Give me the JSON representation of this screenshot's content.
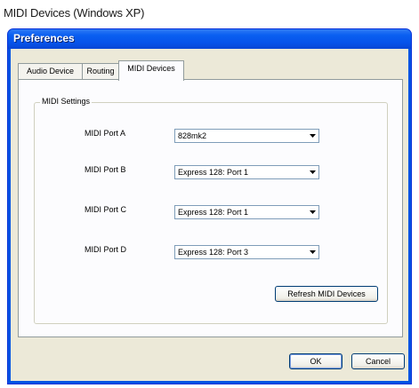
{
  "caption": "MIDI Devices (Windows XP)",
  "window": {
    "title": "Preferences"
  },
  "tabs": [
    {
      "label": "Audio Device"
    },
    {
      "label": "Routing"
    },
    {
      "label": "MIDI Devices"
    }
  ],
  "midi_settings": {
    "legend": "MIDI Settings",
    "ports": [
      {
        "label": "MIDI Port A",
        "value": "828mk2"
      },
      {
        "label": "MIDI Port B",
        "value": "Express  128: Port 1"
      },
      {
        "label": "MIDI Port C",
        "value": "Express  128: Port 1"
      },
      {
        "label": "MIDI Port D",
        "value": "Express  128: Port 3"
      }
    ],
    "refresh_label": "Refresh MIDI Devices"
  },
  "buttons": {
    "ok": "OK",
    "cancel": "Cancel"
  },
  "icons": {
    "dropdown": "chevron-down-icon"
  },
  "colors": {
    "titlebar": "#0054e3",
    "dialog_bg": "#ece9d8",
    "panel_bg": "#fcfcfe"
  }
}
